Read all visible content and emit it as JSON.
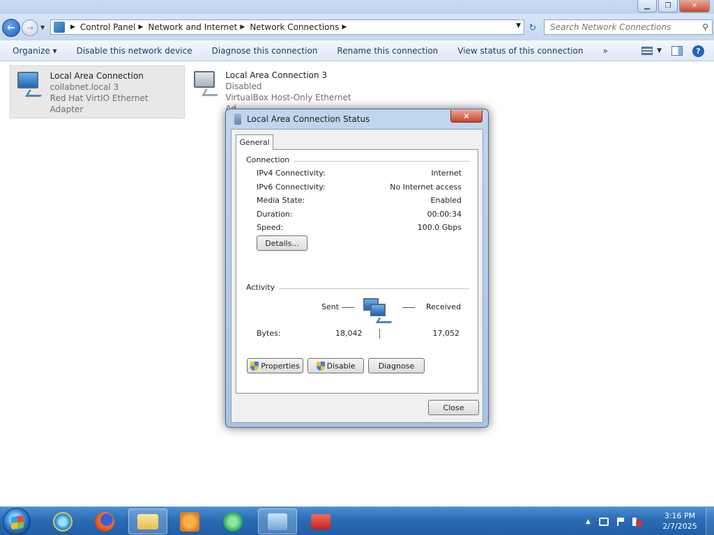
{
  "window": {
    "minimize_glyph": "▁",
    "maximize_glyph": "❐",
    "close_glyph": "✕"
  },
  "nav": {
    "back_glyph": "←",
    "forward_glyph": "→",
    "history_glyph": "▼",
    "breadcrumbs": [
      "Control Panel",
      "Network and Internet",
      "Network Connections"
    ],
    "crumb_separator": "▶",
    "dropdown_glyph": "▼",
    "refresh_glyph": "↻",
    "search_placeholder": "Search Network Connections",
    "search_glyph": "⚲"
  },
  "commandbar": {
    "items": [
      "Organize ▾",
      "Disable this network device",
      "Diagnose this connection",
      "Rename this connection",
      "View status of this connection",
      "»"
    ],
    "view_dropdown_glyph": "▼",
    "help_glyph": "?"
  },
  "connections": [
    {
      "name": "Local Area Connection",
      "status": "collabnet.local  3",
      "adapter": "Red Hat VirtIO Ethernet Adapter",
      "selected": true
    },
    {
      "name": "Local Area Connection 3",
      "status": "Disabled",
      "adapter": "VirtualBox Host-Only Ethernet Ad...",
      "selected": false
    }
  ],
  "dialog": {
    "title": "Local Area Connection Status",
    "close_glyph": "✕",
    "tab": "General",
    "connection": {
      "label": "Connection",
      "rows": [
        {
          "key": "IPv4 Connectivity:",
          "value": "Internet"
        },
        {
          "key": "IPv6 Connectivity:",
          "value": "No Internet access"
        },
        {
          "key": "Media State:",
          "value": "Enabled"
        },
        {
          "key": "Duration:",
          "value": "00:00:34"
        },
        {
          "key": "Speed:",
          "value": "100.0 Gbps"
        }
      ],
      "details_button": "Details..."
    },
    "activity": {
      "label": "Activity",
      "sent_label": "Sent",
      "received_label": "Received",
      "bytes_label": "Bytes:",
      "bytes_sent": "18,042",
      "bytes_received": "17,052"
    },
    "buttons": {
      "properties": "Properties",
      "disable": "Disable",
      "diagnose": "Diagnose",
      "close": "Close"
    }
  },
  "taskbar": {
    "clock_time": "3:16 PM",
    "clock_date": "2/7/2025",
    "tray_expand_glyph": "▲"
  }
}
